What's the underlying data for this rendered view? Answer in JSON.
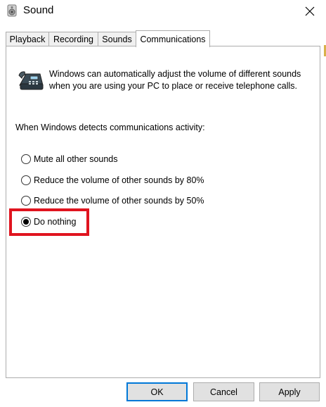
{
  "window": {
    "title": "Sound",
    "close_glyph": "✕"
  },
  "tabs": [
    {
      "label": "Playback",
      "active": false
    },
    {
      "label": "Recording",
      "active": false
    },
    {
      "label": "Sounds",
      "active": false
    },
    {
      "label": "Communications",
      "active": true
    }
  ],
  "communications": {
    "description": "Windows can automatically adjust the volume of different sounds when you are using your PC to place or receive telephone calls.",
    "detect_label": "When Windows detects communications activity:",
    "options": [
      {
        "label": "Mute all other sounds",
        "selected": false
      },
      {
        "label": "Reduce the volume of other sounds by 80%",
        "selected": false
      },
      {
        "label": "Reduce the volume of other sounds by 50%",
        "selected": false
      },
      {
        "label": "Do nothing",
        "selected": true
      }
    ]
  },
  "buttons": {
    "ok": "OK",
    "cancel": "Cancel",
    "apply": "Apply"
  },
  "colors": {
    "highlight": "#e0141f",
    "default_button_border": "#0078d7"
  }
}
